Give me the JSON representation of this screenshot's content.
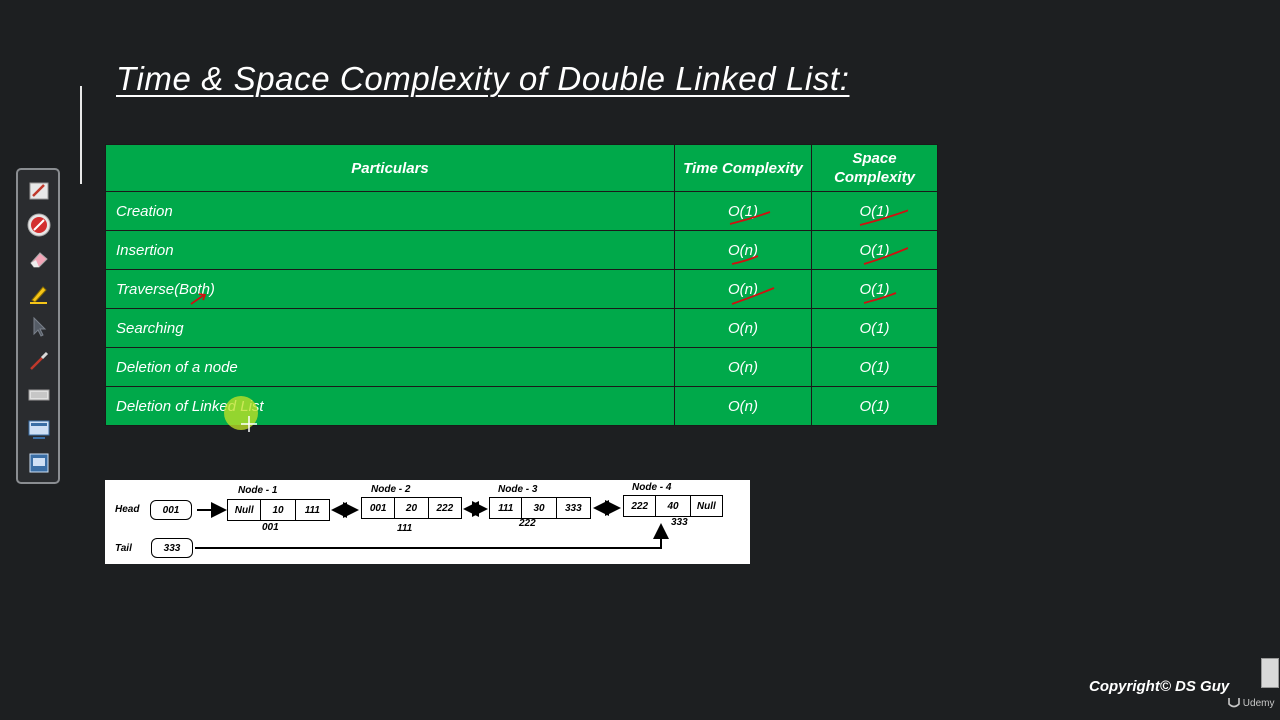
{
  "slide": {
    "title": "Time & Space Complexity of Double Linked List:"
  },
  "toolbar": {
    "tools": [
      "pen-icon",
      "laser-pointer-icon",
      "eraser-icon",
      "highlighter-icon",
      "cursor-arrow-icon",
      "brush-icon",
      "keyboard-icon",
      "whiteboard-icon",
      "screen-capture-icon"
    ]
  },
  "table": {
    "headers": {
      "particulars": "Particulars",
      "time": "Time Complexity",
      "space": "Space Complexity"
    },
    "rows": [
      {
        "particular": "Creation",
        "time": "O(1)",
        "space": "O(1)"
      },
      {
        "particular": "Insertion",
        "time": "O(n)",
        "space": "O(1)"
      },
      {
        "particular": "Traverse(Both)",
        "time": "O(n)",
        "space": "O(1)"
      },
      {
        "particular": "Searching",
        "time": "O(n)",
        "space": "O(1)"
      },
      {
        "particular": "Deletion of a node",
        "time": "O(n)",
        "space": "O(1)"
      },
      {
        "particular": "Deletion of Linked List",
        "time": "O(n)",
        "space": "O(1)"
      }
    ]
  },
  "diagram": {
    "head_label": "Head",
    "head_value": "001",
    "tail_label": "Tail",
    "tail_value": "333",
    "nodes": [
      {
        "title": "Node - 1",
        "cells": [
          "Null",
          "10",
          "111"
        ],
        "address": "001"
      },
      {
        "title": "Node - 2",
        "cells": [
          "001",
          "20",
          "222"
        ],
        "address": "111"
      },
      {
        "title": "Node - 3",
        "cells": [
          "111",
          "30",
          "333"
        ],
        "address": "222"
      },
      {
        "title": "Node - 4",
        "cells": [
          "222",
          "40",
          "Null"
        ],
        "address": "333"
      }
    ]
  },
  "footer": {
    "copyright": "Copyright© DS Guy",
    "brand": "Udemy"
  }
}
